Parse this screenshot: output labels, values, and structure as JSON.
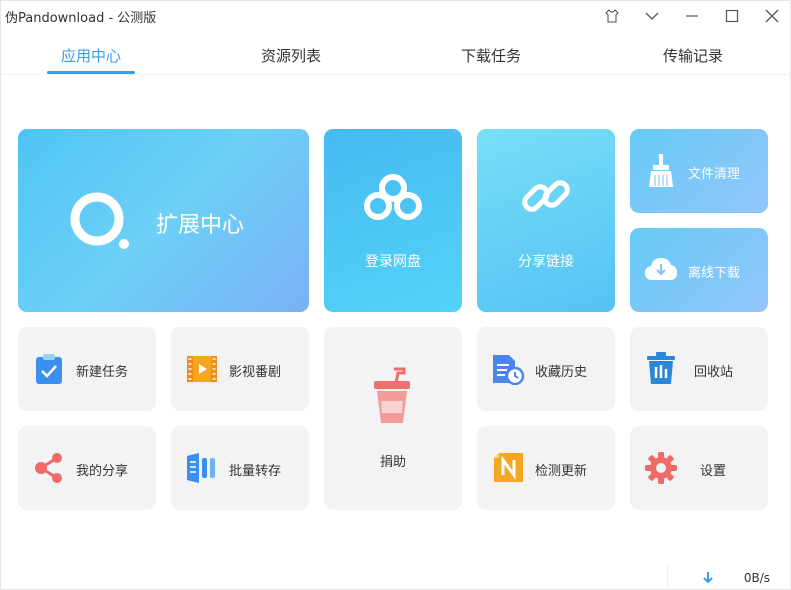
{
  "window": {
    "title": "伪Pandownload - 公测版"
  },
  "tabs": [
    {
      "label": "应用中心"
    },
    {
      "label": "资源列表"
    },
    {
      "label": "下载任务"
    },
    {
      "label": "传输记录"
    }
  ],
  "tiles": {
    "extension_center": "扩展中心",
    "login_netdisk": "登录网盘",
    "share_link": "分享链接",
    "file_cleanup": "文件清理",
    "offline_download": "离线下载",
    "new_task": "新建任务",
    "video_series": "影视番剧",
    "donate": "捐助",
    "favorites_history": "收藏历史",
    "recycle_bin": "回收站",
    "my_share": "我的分享",
    "batch_save": "批量转存",
    "check_update": "检测更新",
    "settings": "设置"
  },
  "status": {
    "speed": "0B/s"
  },
  "colors": {
    "accent": "#3a9de8"
  }
}
